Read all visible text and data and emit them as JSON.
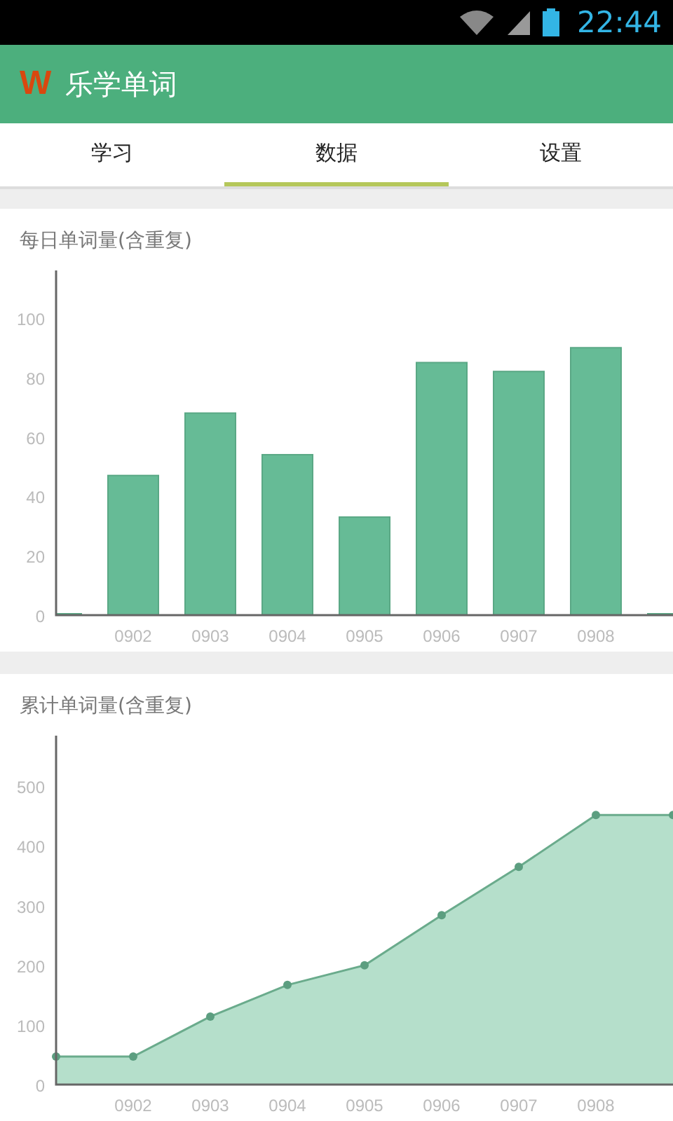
{
  "status_bar": {
    "time": "22:44"
  },
  "app_bar": {
    "logo": "W",
    "title": "乐学单词"
  },
  "tabs": [
    {
      "label": "学习",
      "selected": false
    },
    {
      "label": "数据",
      "selected": true
    },
    {
      "label": "设置",
      "selected": false
    }
  ],
  "charts": [
    {
      "title": "每日单词量(含重复)",
      "chart_data": {
        "type": "bar",
        "categories": [
          null,
          "0902",
          "0903",
          "0904",
          "0905",
          "0906",
          "0907",
          "0908",
          null
        ],
        "values": [
          0,
          47,
          68,
          54,
          33,
          85,
          82,
          90,
          0
        ],
        "ylim": [
          0,
          116
        ],
        "yticks": [
          0,
          20,
          40,
          60,
          80,
          100
        ]
      }
    },
    {
      "title": "累计单词量(含重复)",
      "chart_data": {
        "type": "area",
        "categories": [
          null,
          "0902",
          "0903",
          "0904",
          "0905",
          "0906",
          "0907",
          "0908",
          null
        ],
        "values": [
          47,
          47,
          114,
          167,
          200,
          284,
          365,
          452,
          452
        ],
        "ylim": [
          0,
          585
        ],
        "yticks": [
          0,
          100,
          200,
          300,
          400,
          500
        ]
      }
    }
  ]
}
